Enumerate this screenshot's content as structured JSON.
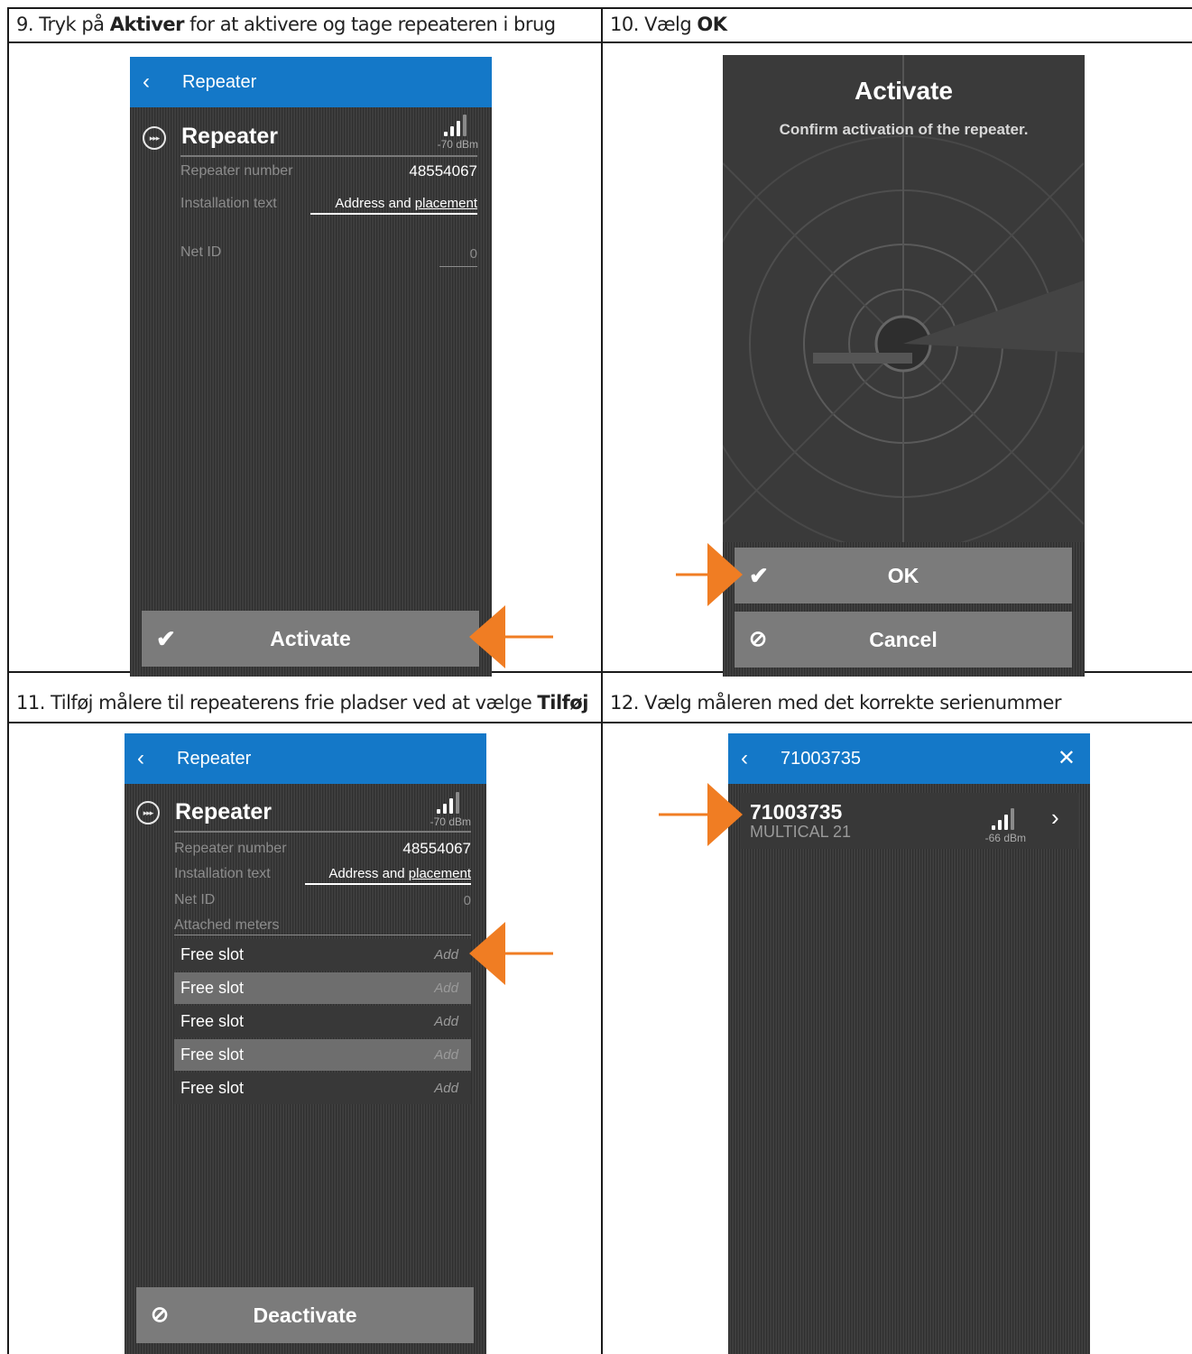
{
  "cells": {
    "c1": {
      "step": "9. Tryk på ",
      "bold": "Aktiver",
      "rest": " for at aktivere og tage repeateren i brug"
    },
    "c2": {
      "step": "10. Vælg ",
      "bold": "OK",
      "rest": ""
    },
    "c3": {
      "step": "11. Tilføj målere til repeaterens frie pladser ved at vælge ",
      "bold": "Tilføj",
      "rest": ""
    },
    "c4": {
      "step": "12. Vælg måleren med det korrekte serienummer",
      "bold": "",
      "rest": ""
    }
  },
  "screen1": {
    "appbar_title": "Repeater",
    "device_title": "Repeater",
    "signal": "-70 dBm",
    "rows": [
      {
        "label": "Repeater number",
        "value": "48554067"
      },
      {
        "label": "Installation text",
        "value_a": "Address and ",
        "value_b": "placement"
      },
      {
        "label": "Net ID",
        "value": "0"
      }
    ],
    "button": "Activate"
  },
  "screen2": {
    "title": "Activate",
    "subtitle": "Confirm activation of the repeater.",
    "ok": "OK",
    "cancel": "Cancel"
  },
  "screen3": {
    "appbar_title": "Repeater",
    "device_title": "Repeater",
    "signal": "-70 dBm",
    "rows": [
      {
        "label": "Repeater number",
        "value": "48554067"
      },
      {
        "label": "Installation text",
        "value_a": "Address and ",
        "value_b": "placement"
      },
      {
        "label": "Net ID",
        "value": "0"
      },
      {
        "label": "Attached meters"
      }
    ],
    "slots": [
      {
        "label": "Free slot",
        "action": "Add"
      },
      {
        "label": "Free slot",
        "action": "Add"
      },
      {
        "label": "Free slot",
        "action": "Add"
      },
      {
        "label": "Free slot",
        "action": "Add"
      },
      {
        "label": "Free slot",
        "action": "Add"
      }
    ],
    "button": "Deactivate"
  },
  "screen4": {
    "appbar_title": "71003735",
    "meter_number": "71003735",
    "meter_type": "MULTICAL 21",
    "signal": "-66 dBm"
  },
  "colors": {
    "appbar": "#1478c8",
    "arrow": "#f07d23",
    "button": "#7b7b7b"
  }
}
